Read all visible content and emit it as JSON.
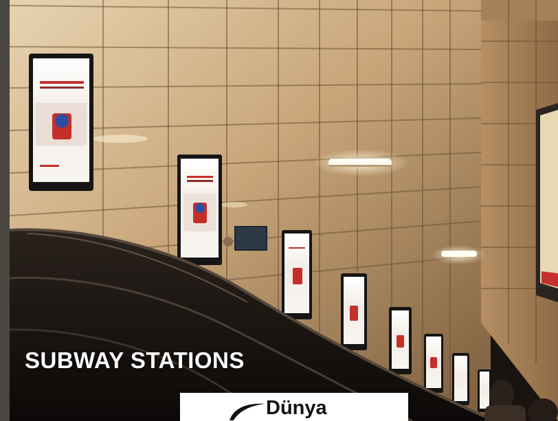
{
  "caption": "SUBWAY STATIONS",
  "logo": {
    "text": "Dünya",
    "icon": "swoosh-icon"
  },
  "colors": {
    "wall": "#c9a77a",
    "caption": "#ffffff",
    "logo_bg": "#ffffff"
  }
}
